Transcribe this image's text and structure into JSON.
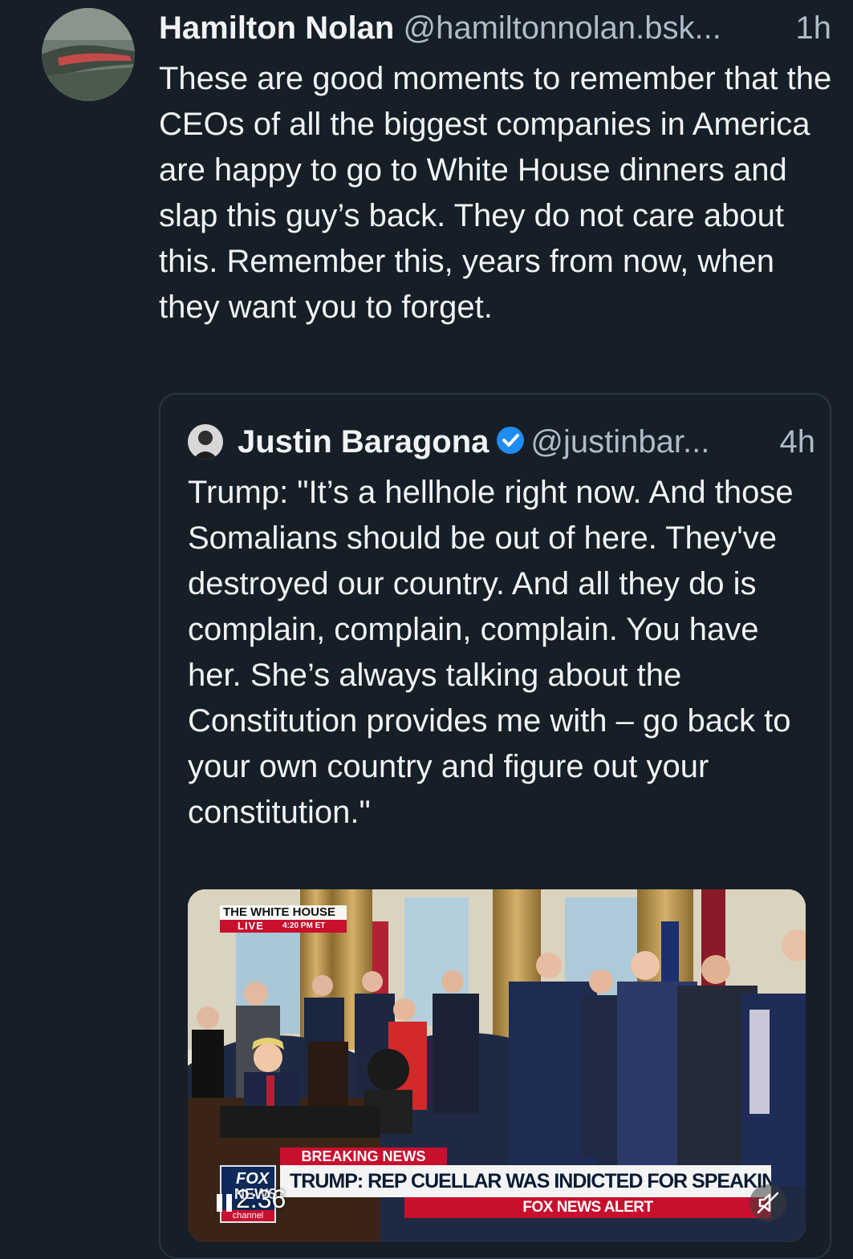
{
  "post": {
    "author_name": "Hamilton Nolan",
    "author_handle": "@hamiltonnolan.bsk...",
    "time": "1h",
    "text": "These are good moments to remember that the CEOs of all the biggest companies in America are happy to go to White House dinners and slap this guy’s back. They do not care about this. Remember this, years from now, when they want you to forget."
  },
  "quote": {
    "author_name": "Justin Baragona",
    "author_handle": "@justinbar...",
    "time": "4h",
    "text": "Trump: \"It’s a hellhole right now. And those Somalians should be out of here. They've destroyed our country. And all they do is complain, complain, complain. You have her. She’s always talking about the Constitution provides me with – go back to your own country and figure out your constitution.\""
  },
  "video": {
    "chyron_top": "THE WHITE HOUSE",
    "live_label": "LIVE",
    "live_time": "4:20 PM ET",
    "breaking_label": "BREAKING NEWS",
    "headline": "TRUMP: REP CUELLAR WAS INDICTED FOR SPEAKING TRUTH",
    "alert_label": "FOX NEWS ALERT",
    "logo_line1": "FOX",
    "logo_line2": "NEWS",
    "logo_line3": "channel",
    "duration": "2:36"
  },
  "colors": {
    "background": "#161e27",
    "muted_text": "#aebbc9",
    "verified_blue": "#1e8cf0",
    "fox_red": "#c8102e"
  }
}
